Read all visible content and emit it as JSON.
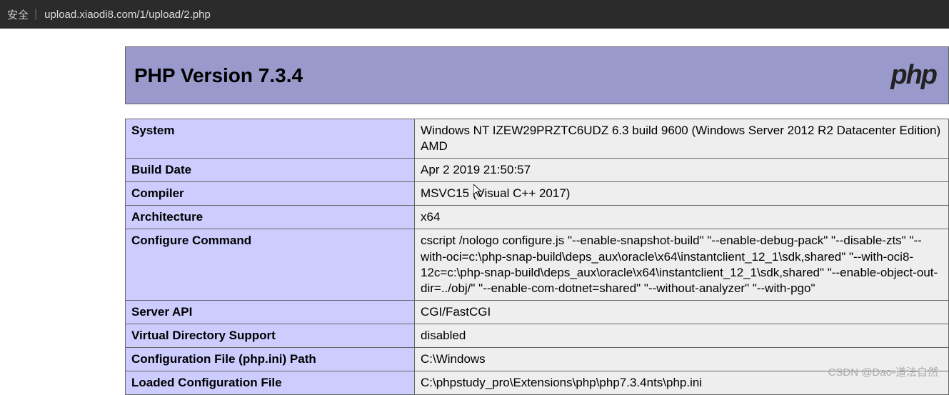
{
  "browser": {
    "security": "安全",
    "url": "upload.xiaodi8.com/1/upload/2.php"
  },
  "header": {
    "title": "PHP Version 7.3.4",
    "logo_text": "php"
  },
  "table": {
    "rows": [
      {
        "label": "System",
        "value": "Windows NT IZEW29PRZTC6UDZ 6.3 build 9600 (Windows Server 2012 R2 Datacenter Edition) AMD"
      },
      {
        "label": "Build Date",
        "value": "Apr 2 2019 21:50:57"
      },
      {
        "label": "Compiler",
        "value": "MSVC15 (Visual C++ 2017)"
      },
      {
        "label": "Architecture",
        "value": "x64"
      },
      {
        "label": "Configure Command",
        "value": "cscript /nologo configure.js \"--enable-snapshot-build\" \"--enable-debug-pack\" \"--disable-zts\" \"--with-oci=c:\\php-snap-build\\deps_aux\\oracle\\x64\\instantclient_12_1\\sdk,shared\" \"--with-oci8-12c=c:\\php-snap-build\\deps_aux\\oracle\\x64\\instantclient_12_1\\sdk,shared\" \"--enable-object-out-dir=../obj/\" \"--enable-com-dotnet=shared\" \"--without-analyzer\" \"--with-pgo\""
      },
      {
        "label": "Server API",
        "value": "CGI/FastCGI"
      },
      {
        "label": "Virtual Directory Support",
        "value": "disabled"
      },
      {
        "label": "Configuration File (php.ini) Path",
        "value": "C:\\Windows"
      },
      {
        "label": "Loaded Configuration File",
        "value": "C:\\phpstudy_pro\\Extensions\\php\\php7.3.4nts\\php.ini"
      }
    ]
  },
  "watermark": "CSDN @Dao-道法自然"
}
